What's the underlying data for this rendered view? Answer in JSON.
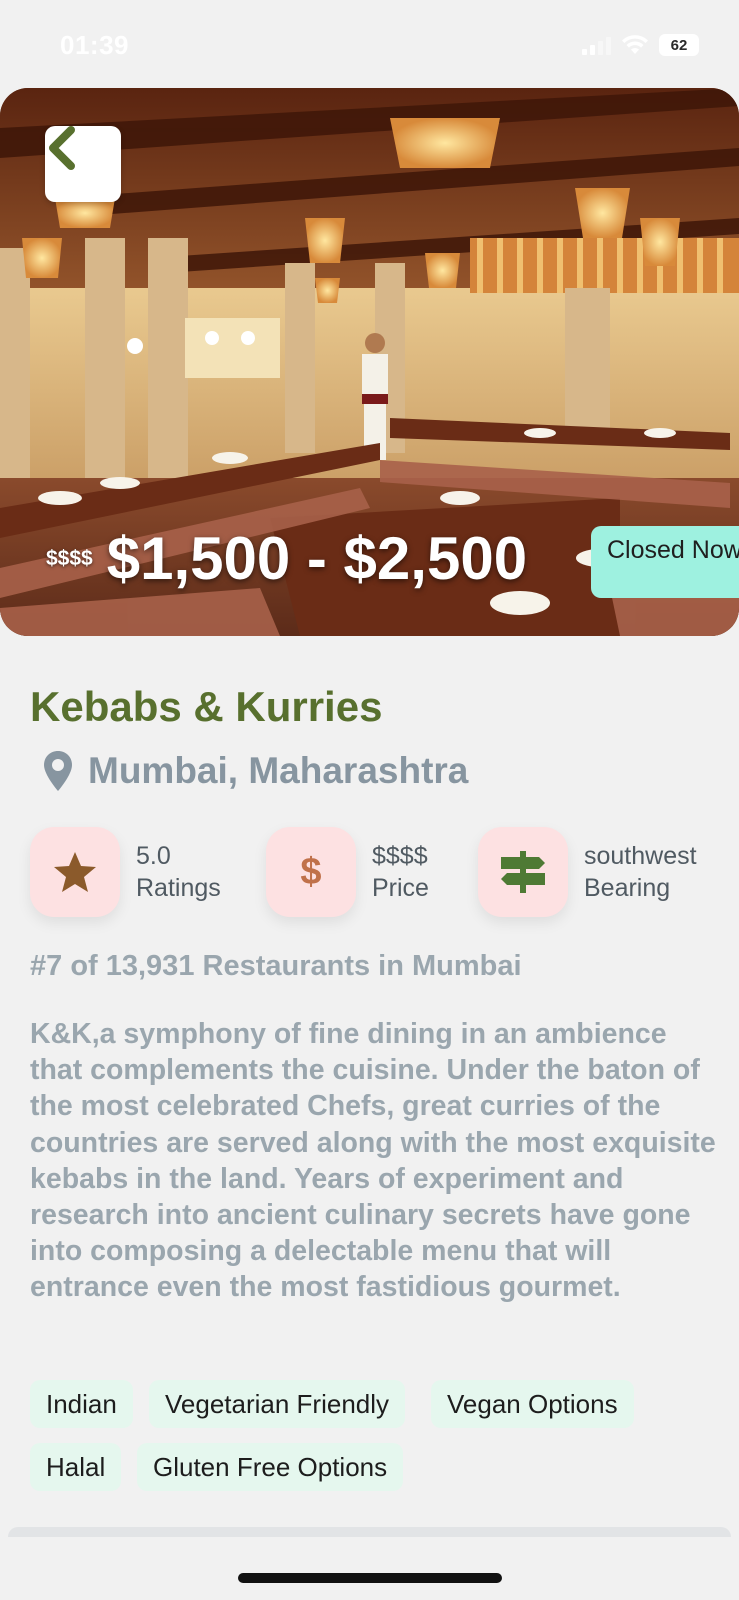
{
  "status_bar": {
    "time": "01:39",
    "battery": "62"
  },
  "hero": {
    "price_level": "$$$$",
    "price_range": "$1,500 - $2,500",
    "open_status": "Closed Now"
  },
  "restaurant": {
    "name": "Kebabs & Kurries",
    "location": "Mumbai, Maharashtra",
    "stats": {
      "rating_value": "5.0",
      "rating_label": "Ratings",
      "price_value": "$$$$",
      "price_label": "Price",
      "bearing_value": "southwest",
      "bearing_label": "Bearing"
    },
    "rank": "#7 of 13,931 Restaurants in Mumbai",
    "description": "K&K,a symphony of fine dining in an ambience that complements the cuisine. Under the baton of the most celebrated Chefs, great curries of the countries are served along with the most exquisite kebabs in the land. Years of experiment and research into ancient culinary secrets have gone into composing a delectable menu that will entrance even the most fastidious gourmet.",
    "tags": [
      "Indian",
      "Vegetarian Friendly",
      "Vegan Options",
      "Halal",
      "Gluten Free Options"
    ]
  },
  "colors": {
    "title_green": "#58702e",
    "muted_text": "#9aa6ae",
    "icon_bg": "#fde1e2",
    "icon_brown": "#8b5a2b",
    "bearing_green": "#4e7a34",
    "tag_bg": "#e5f7ee",
    "status_bg": "#9ef1e0"
  },
  "icons": {
    "back": "chevron-left-icon",
    "location": "map-pin-icon",
    "rating": "star-icon",
    "price": "dollar-icon",
    "bearing": "signpost-icon"
  }
}
